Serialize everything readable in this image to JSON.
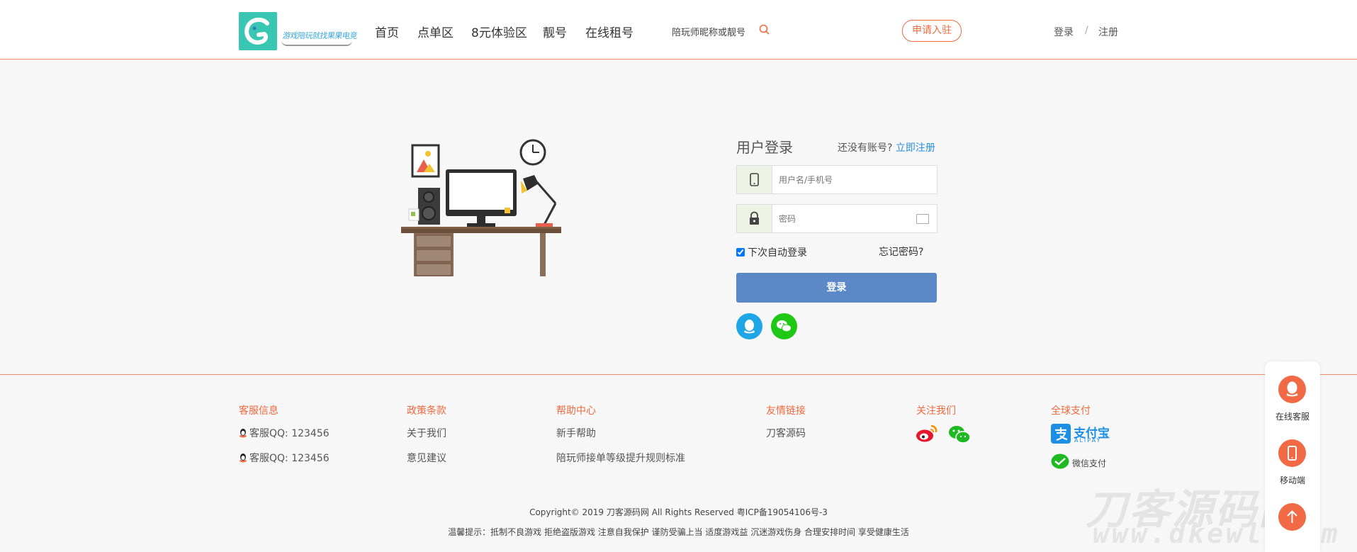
{
  "header": {
    "logo_text": "游戏陪玩就找果果电竞",
    "nav": [
      "首页",
      "点单区",
      "8元体验区",
      "靓号",
      "在线租号"
    ],
    "search_placeholder": "陪玩师昵称或靓号",
    "apply_label": "申请入驻",
    "login_link": "登录",
    "separator": "/",
    "register_link": "注册"
  },
  "login": {
    "title": "用户登录",
    "no_account_text": "还没有账号?",
    "register_now": "立即注册",
    "username_placeholder": "用户名/手机号",
    "password_placeholder": "密码",
    "remember_label": "下次自动登录",
    "forgot_label": "忘记密码?",
    "submit_label": "登录"
  },
  "footer": {
    "columns": {
      "service": {
        "title": "客服信息",
        "items": [
          "客服QQ: 123456",
          "客服QQ: 123456"
        ]
      },
      "policy": {
        "title": "政策条款",
        "items": [
          "关于我们",
          "意见建议"
        ]
      },
      "help": {
        "title": "帮助中心",
        "items": [
          "新手帮助",
          "陪玩师接单等级提升规则标准"
        ]
      },
      "links": {
        "title": "友情链接",
        "items": [
          "刀客源码"
        ]
      },
      "follow": {
        "title": "关注我们"
      },
      "pay": {
        "title": "全球支付",
        "alipay_cn": "支付宝",
        "alipay_en": "ALIPAY",
        "wechat_pay": "微信支付"
      }
    },
    "copyright": "Copyright© 2019 刀客源码网 All Rights Reserved 粤ICP备19054106号-3",
    "tips": "温馨提示：抵制不良游戏 拒绝盗版游戏 注意自我保护 谨防受骗上当 适度游戏益 沉迷游戏伤身 合理安排时间 享受健康生活"
  },
  "float": {
    "service_label": "在线客服",
    "mobile_label": "移动端"
  },
  "watermark": {
    "cn": "刀客源码网",
    "url": "www.dkewl.com"
  },
  "colors": {
    "accent": "#f06a3f",
    "button": "#5b88c6",
    "link": "#2a8fd8",
    "qq": "#1fa6e6",
    "wechat": "#1ec814"
  }
}
